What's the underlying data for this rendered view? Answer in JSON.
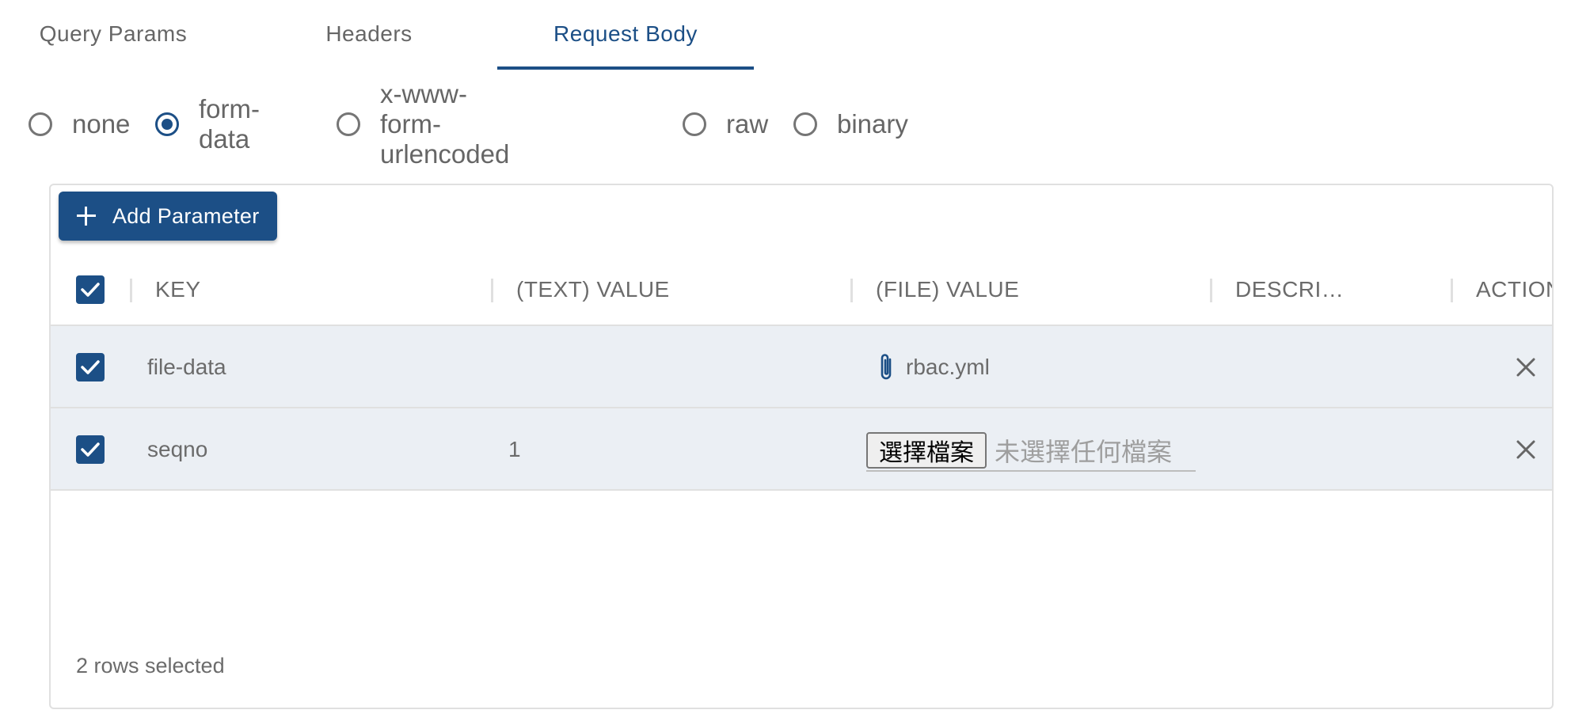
{
  "tabs": [
    {
      "label": "Query Params",
      "active": false
    },
    {
      "label": "Headers",
      "active": false
    },
    {
      "label": "Request Body",
      "active": true
    }
  ],
  "body_types": [
    {
      "label": "none",
      "checked": false
    },
    {
      "label": "form-data",
      "checked": true
    },
    {
      "label": "x-www-form-urlencoded",
      "checked": false
    },
    {
      "label": "raw",
      "checked": false
    },
    {
      "label": "binary",
      "checked": false
    }
  ],
  "grid": {
    "add_button_label": "Add Parameter",
    "columns": [
      "KEY",
      "(TEXT) VALUE",
      "(FILE) VALUE",
      "DESCRI…",
      "ACTION"
    ],
    "rows": [
      {
        "checked": true,
        "key": "file-data",
        "text_value": "",
        "file_value": "rbac.yml",
        "description": ""
      },
      {
        "checked": true,
        "key": "seqno",
        "text_value": "1",
        "file_button": "選擇檔案",
        "file_none": "未選擇任何檔案",
        "description": ""
      }
    ],
    "footer": "2 rows selected"
  },
  "colors": {
    "accent": "#1c4f86",
    "row_bg": "#ebeff4"
  }
}
